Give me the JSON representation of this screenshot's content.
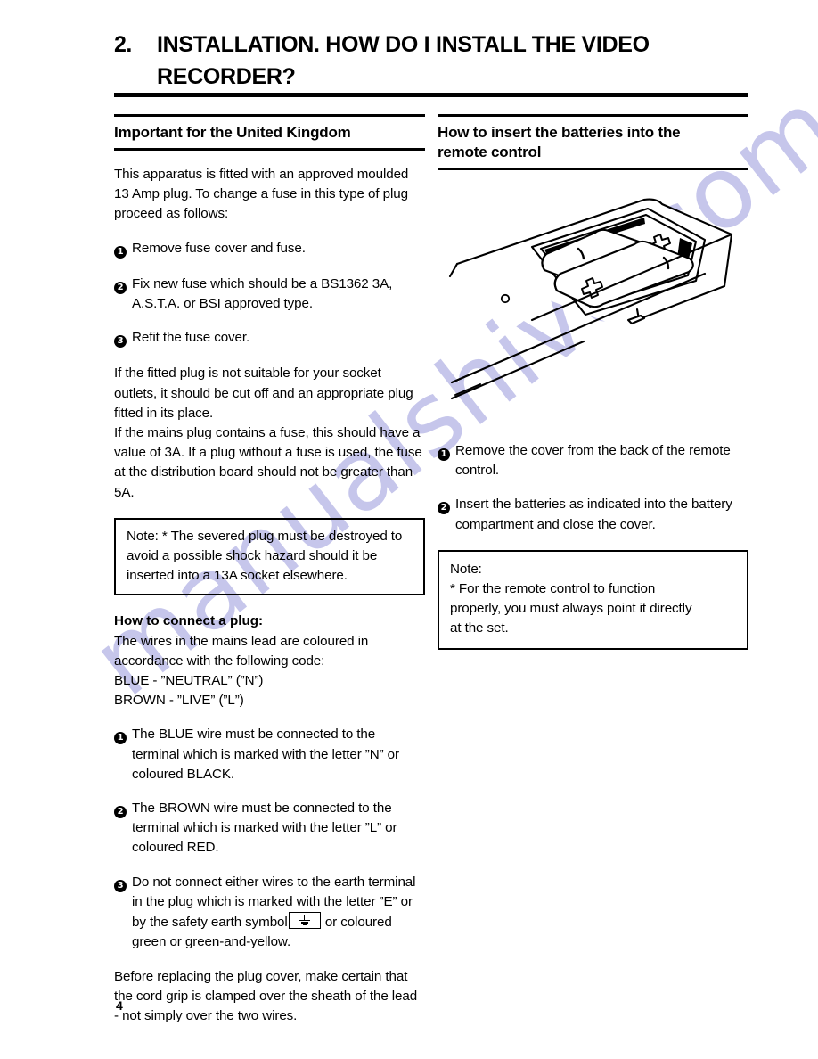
{
  "watermark": {
    "text": "manualshive.com"
  },
  "chapter": {
    "number": "2.",
    "title_line1": "INSTALLATION. HOW DO I INSTALL THE VIDEO",
    "title_line2": "RECORDER?"
  },
  "left_column": {
    "heading": "Important for the United Kingdom",
    "intro": "This apparatus is fitted with an approved moulded 13 Amp plug. To change a fuse in this type of plug proceed as follows:",
    "fuse_steps": [
      {
        "num": "1",
        "text": "Remove fuse cover and fuse."
      },
      {
        "num": "2",
        "text": "Fix new fuse which should be a BS1362 3A, A.S.T.A. or BSI approved type."
      },
      {
        "num": "3",
        "text": "Refit the fuse cover."
      }
    ],
    "para_socket": "If the fitted plug is not suitable for your socket outlets, it should be cut off and an appropriate plug fitted in its place.",
    "para_mains": "If the mains plug contains a fuse, this should have a value of 3A. If a plug without a fuse is used, the fuse at the distribution board should not be greater than 5A.",
    "note_severed": "Note: * The severed plug must be destroyed to avoid a possible shock hazard should it be inserted into a 13A socket elsewhere.",
    "connect_heading": "How to connect a plug:",
    "connect_intro": "The wires in the mains lead are coloured in accordance with the following code:",
    "code_blue": "BLUE - ”NEUTRAL” (”N”)",
    "code_brown": "BROWN - ”LIVE” (”L”)",
    "wire_steps": [
      {
        "num": "1",
        "text": "The BLUE wire must be connected to the terminal which is marked with the letter ”N” or coloured BLACK."
      },
      {
        "num": "2",
        "text": "The BROWN wire must be connected to the terminal which is marked with the letter ”L” or coloured RED."
      }
    ],
    "earth_step": {
      "num": "3",
      "text_before": "Do not connect either wires to the earth terminal in the plug which is marked with the letter ”E” or by the safety earth symbol",
      "symbol": "earth-ground-symbol",
      "text_after": "or coloured green or green-and-yellow."
    },
    "para_cordgrip": "Before replacing the plug cover, make certain that the cord grip is clamped over the sheath of the lead - not simply over the two wires."
  },
  "right_column": {
    "heading_line1": "How to insert the batteries into the",
    "heading_line2": "remote control",
    "illustration": {
      "name": "remote-control-battery-compartment",
      "description": "Line drawing of the back of the remote control with the battery cover removed, showing two batteries inserted with plus terminals"
    },
    "battery_steps": [
      {
        "num": "1",
        "text": "Remove the cover from the back of the remote control."
      },
      {
        "num": "2",
        "text": "Insert the batteries as indicated into the battery compartment and close the cover."
      }
    ],
    "note": {
      "label": "Note:",
      "line1": "* For the remote control to function",
      "line2": "properly, you must always point it directly",
      "line3": "at the set."
    }
  },
  "footer": {
    "page_number": "4"
  }
}
